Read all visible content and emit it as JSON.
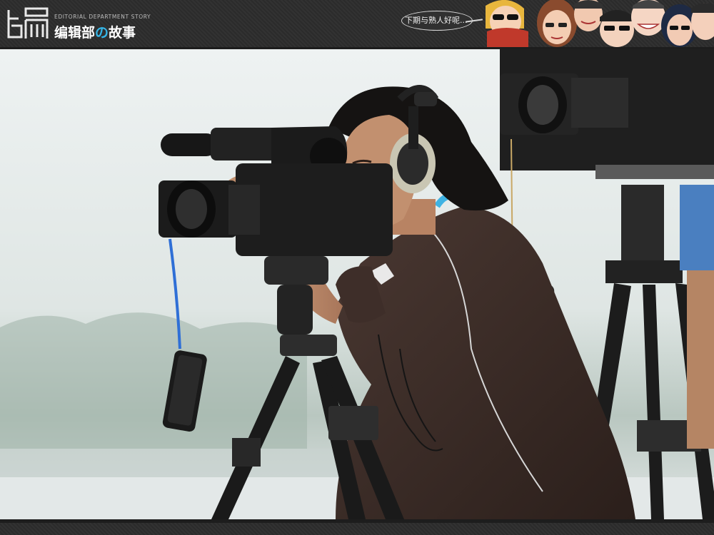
{
  "header": {
    "logo_text": "骗",
    "en_tag": "EDITORIAL DEPARTMENT STORY",
    "cn_title_part1": "编辑部",
    "cn_title_no": "の",
    "cn_title_part2": "故事",
    "bubble_text": "下期与熟人好呢..."
  },
  "colors": {
    "banner": "#2b2b2b",
    "accent": "#35b6e8",
    "shirt": "#3a2a25",
    "sky": "#e6ebea"
  },
  "icons": [
    "cartoon-faces-strip",
    "video-camera-icon",
    "tripod-icon",
    "headphones-icon"
  ]
}
